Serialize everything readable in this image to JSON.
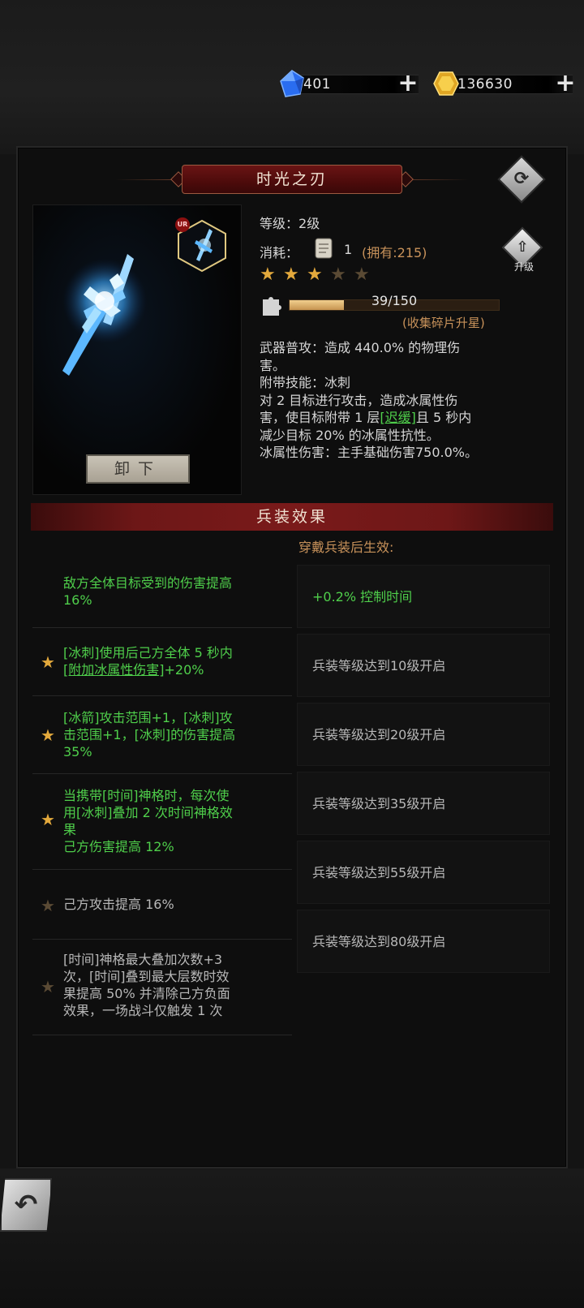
{
  "currency": {
    "gems": "401",
    "gold": "136630"
  },
  "item": {
    "name": "时光之刃",
    "level_label": "等级：",
    "level_value": "2级",
    "cost_label": "消耗：",
    "cost_amount": "1",
    "owned": "(拥有:215)",
    "upgrade_label": "升级",
    "stars_filled": 3,
    "stars_total": 5,
    "progress_text": "39/150",
    "progress_current": 39,
    "progress_max": 150,
    "progress_hint": "(收集碎片升星)",
    "desc_line1": "武器普攻：造成 440.0% 的物理伤",
    "desc_line2": "害。",
    "desc_line3": "附带技能：冰刺",
    "desc_line4": "对 2 目标进行攻击，造成冰属性伤",
    "desc_line5a": "害，使目标附带 1 层",
    "desc_line5_link": "[迟缓]",
    "desc_line5b": "且 5 秒内",
    "desc_line6": "减少目标 20% 的冰属性抗性。",
    "desc_line7": "冰属性伤害：主手基础伤害750.0%。",
    "unequip_label": "卸下",
    "quality_badge": "UR"
  },
  "effects": {
    "title": "兵装效果",
    "wear_hint": "穿戴兵装后生效:",
    "rows": [
      {
        "l1": "敌方全体目标受到的伤害提高",
        "l2": "16%"
      },
      {
        "l1": "[冰刺]使用后己方全体 5 秒内",
        "l2": "[附加冰属性伤害]",
        "l2b": "+20%"
      },
      {
        "l1": "[冰箭]攻击范围+1，[冰刺]攻",
        "l2": "击范围+1，[冰刺]的伤害提高",
        "l3": "35%"
      },
      {
        "l1": "当携带[时间]神格时，每次使",
        "l2": "用[冰刺]叠加 2 次时间神格效",
        "l3": "果",
        "l4": "己方伤害提高 12%"
      },
      {
        "l1": "己方攻击提高 16%"
      },
      {
        "l1": "[时间]神格最大叠加次数+3",
        "l2": "次，[时间]叠到最大层数时效",
        "l3": "果提高 50% 并清除己方负面",
        "l4": "效果，一场战斗仅触发 1 次"
      }
    ],
    "boxes": [
      "+0.2% 控制时间",
      "兵装等级达到10级开启",
      "兵装等级达到20级开启",
      "兵装等级达到35级开启",
      "兵装等级达到55级开启",
      "兵装等级达到80级开启"
    ]
  },
  "colors": {
    "green": "#4fcf4b",
    "gold": "#c8925a",
    "banner_red": "#6d1717"
  }
}
